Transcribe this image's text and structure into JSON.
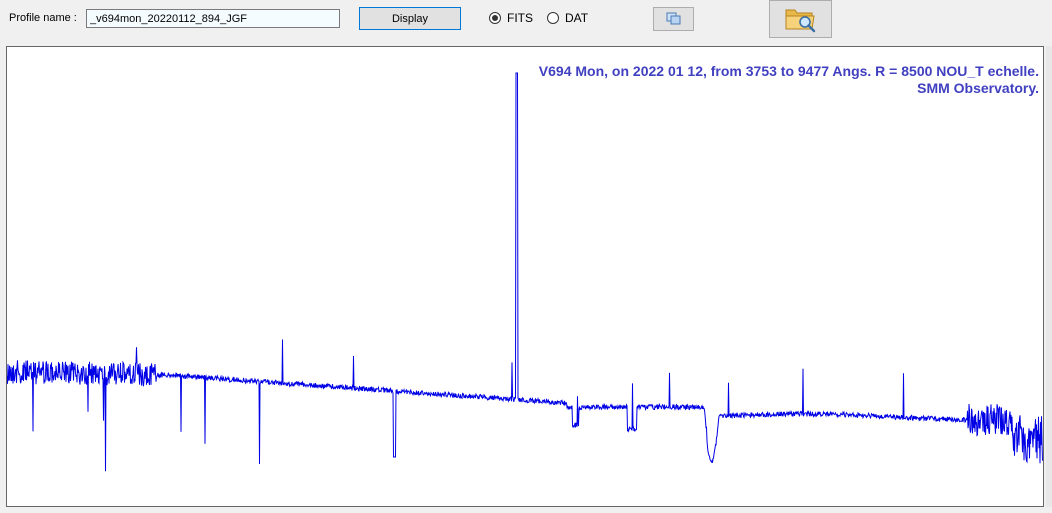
{
  "toolbar": {
    "profile_label": "Profile name :",
    "profile_value": "_v694mon_20220112_894_JGF",
    "display_label": "Display",
    "format_options": [
      "FITS",
      "DAT"
    ],
    "format_selected": "FITS",
    "copy_icon": "copy-icon",
    "open_icon": "folder-search-icon"
  },
  "plot": {
    "title_line1": "V694 Mon, on 2022 01 12, from 3753 to 9477 Angs. R = 8500 NOU_T echelle.",
    "title_line2": "SMM Observatory.",
    "line_color": "#0000e6",
    "title_color": "#4040c0"
  },
  "chart_data": {
    "type": "line",
    "title": "V694 Mon, on 2022 01 12, from 3753 to 9477 Angs. R = 8500 NOU_T echelle. SMM Observatory.",
    "xlim": [
      3753,
      9477
    ],
    "x_unit": "Angstrom",
    "grid": false,
    "axes_visible": false,
    "features": [
      {
        "wavelength": 6563,
        "kind": "emission",
        "note": "strong narrow emission peak"
      },
      {
        "wavelength": 6870,
        "kind": "absorption",
        "note": "telluric band"
      },
      {
        "wavelength": 7600,
        "kind": "absorption",
        "note": "telluric band"
      }
    ]
  }
}
